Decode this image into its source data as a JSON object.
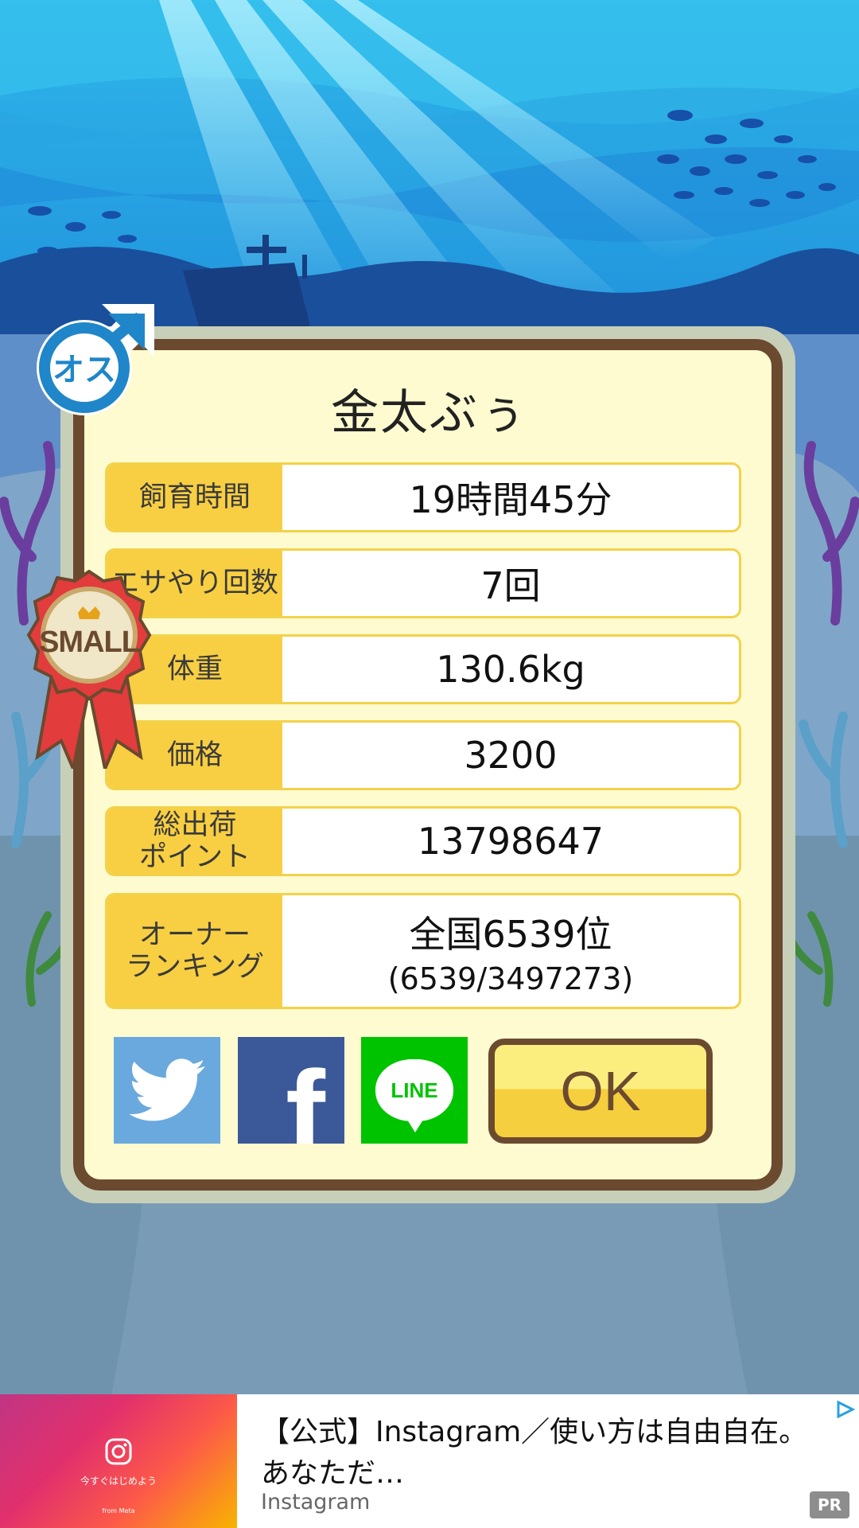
{
  "pet": {
    "name": "金太ぶぅ",
    "gender_label": "オス",
    "size_label": "SMALL"
  },
  "stats": [
    {
      "label": "飼育時間",
      "value": "19時間45分"
    },
    {
      "label": "エサやり回数",
      "value": "7回"
    },
    {
      "label": "体重",
      "value": "130.6kg"
    },
    {
      "label": "価格",
      "value": "3200"
    },
    {
      "label": "総出荷\nポイント",
      "value": "13798647"
    }
  ],
  "ranking": {
    "label": "オーナー\nランキング",
    "value": "全国6539位",
    "detail": "(6539/3497273)"
  },
  "share": {
    "twitter": "twitter-icon",
    "facebook_glyph": "f",
    "line_label": "LINE"
  },
  "ok_label": "OK",
  "ad": {
    "image_tagline": "今すぐはじめよう",
    "image_meta": "from Meta",
    "title": "【公式】Instagram／使い方は自由自在。あなただ…",
    "source": "Instagram",
    "badge": "PR"
  },
  "colors": {
    "label_bg": "#f8cf42",
    "card_bg": "#fffbd0",
    "card_border": "#6b4a2f",
    "twitter": "#6aa9dd",
    "facebook": "#3b5998",
    "line": "#00c300",
    "badge_blue": "#1f86c9",
    "ribbon_red": "#e23c3c"
  }
}
